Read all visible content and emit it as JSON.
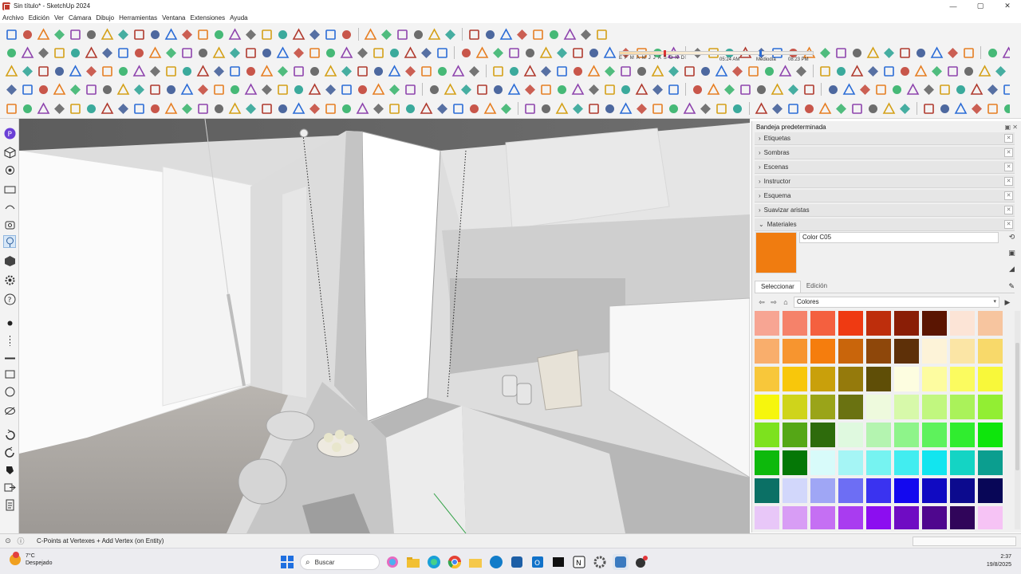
{
  "window": {
    "title": "Sin título* - SketchUp 2024",
    "controls": [
      "—",
      "▢",
      "✕"
    ]
  },
  "menu": [
    "Archivo",
    "Edición",
    "Ver",
    "Cámara",
    "Dibujo",
    "Herramientas",
    "Ventana",
    "Extensiones",
    "Ayuda"
  ],
  "shadows": {
    "months": [
      "E",
      "F",
      "M",
      "A",
      "M",
      "J",
      "J",
      "A",
      "S",
      "O",
      "N",
      "D"
    ],
    "time_start": "05:24 AM",
    "time_mid": "Mediodía",
    "time_end": "08:23 PM"
  },
  "tray": {
    "title": "Bandeja predeterminada",
    "panels": [
      {
        "label": "Etiquetas",
        "expanded": false
      },
      {
        "label": "Sombras",
        "expanded": false
      },
      {
        "label": "Escenas",
        "expanded": false
      },
      {
        "label": "Instructor",
        "expanded": false
      },
      {
        "label": "Esquema",
        "expanded": false
      },
      {
        "label": "Suavizar aristas",
        "expanded": false
      },
      {
        "label": "Materiales",
        "expanded": true
      }
    ],
    "materials": {
      "current_name": "Color C05",
      "current_color": "#f07c10",
      "tabs": [
        "Seleccionar",
        "Edición"
      ],
      "active_tab": "Seleccionar",
      "library": "Colores",
      "palette": [
        "#f7a593",
        "#f5826a",
        "#f4603f",
        "#ef3a12",
        "#be2e0c",
        "#8a1e06",
        "#5a1502",
        "#fce4d6",
        "#f7c59f",
        "#f9ae6c",
        "#f7952f",
        "#f57d0d",
        "#c9650b",
        "#8e470a",
        "#5e3008",
        "#fdf3d8",
        "#fbe5a5",
        "#f8d96a",
        "#f8c73a",
        "#f8c70b",
        "#c9a00b",
        "#957a0c",
        "#5f4e07",
        "#fdfde0",
        "#fdfca0",
        "#fbfb5f",
        "#f8f83a",
        "#f6f60d",
        "#cfd41b",
        "#9aa419",
        "#6a7211",
        "#eefadd",
        "#d7f9aa",
        "#c1f77f",
        "#aaf25a",
        "#92ee33",
        "#7de21e",
        "#55a716",
        "#2e6b0c",
        "#dff9df",
        "#b4f4b0",
        "#8ef48a",
        "#5ef25c",
        "#30ed2f",
        "#0ee50c",
        "#0db90c",
        "#057706",
        "#d8fbfa",
        "#a5f5f5",
        "#76f3f1",
        "#42edf0",
        "#12e5ef",
        "#14d4c4",
        "#0b9e8f",
        "#0b7065",
        "#d2d7fb",
        "#9fa6f5",
        "#6d6ef4",
        "#3a33f0",
        "#1308ef",
        "#100ac2",
        "#0c0a8e",
        "#080657",
        "#e8c7f8",
        "#d89df5",
        "#c56ff3",
        "#a93cf0",
        "#8c0ef0",
        "#6f0cc3",
        "#4f078e",
        "#30055a",
        "#f6c3f5"
      ]
    }
  },
  "status": {
    "message": "C-Points at Vertexes + Add Vertex (on Entity)"
  },
  "taskbar": {
    "weather_temp": "7°C",
    "weather_desc": "Despejado",
    "search_placeholder": "Buscar",
    "time": "2:37",
    "date": "19/8/2025"
  }
}
